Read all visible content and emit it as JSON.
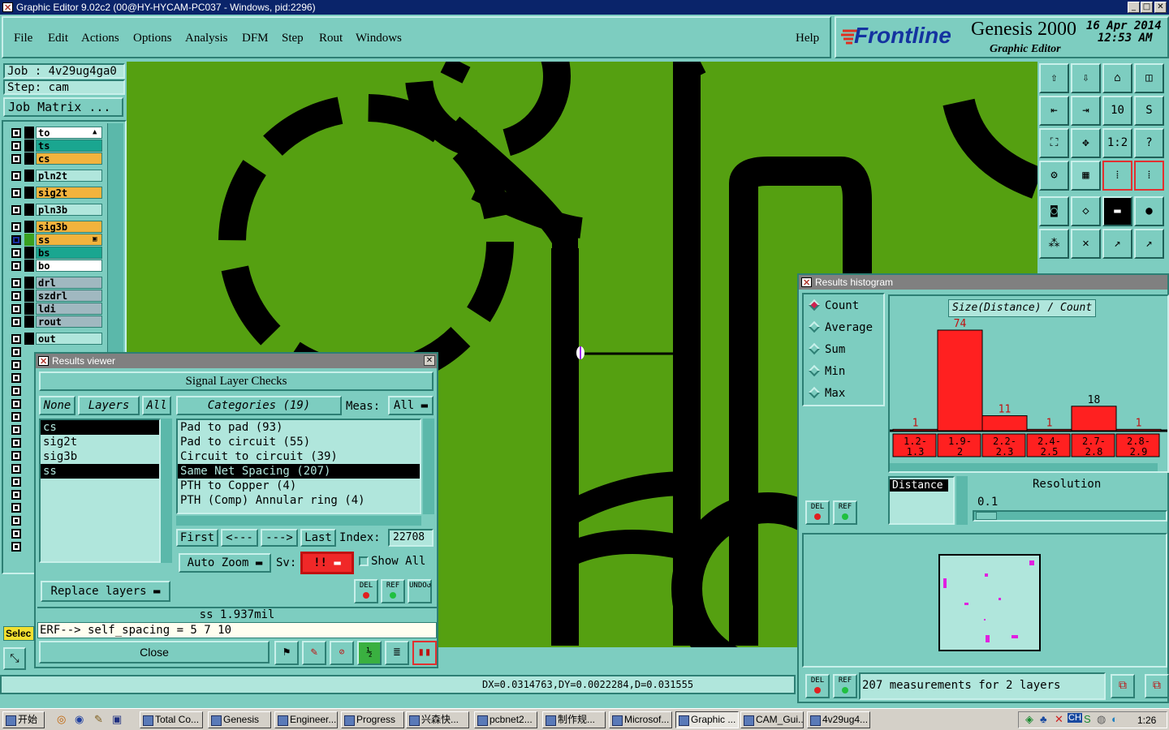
{
  "window": {
    "title": "Graphic Editor 9.02c2 (00@HY-HYCAM-PC037 - Windows, pid:2296)",
    "min": "_",
    "max": "□",
    "close": "✕"
  },
  "menu": [
    "File",
    "Edit",
    "Actions",
    "Options",
    "Analysis",
    "DFM",
    "Step",
    "Rout",
    "Windows"
  ],
  "help": "Help",
  "brand": {
    "logo": "Frontline",
    "product": "Genesis 2000",
    "subtitle": "Graphic Editor",
    "date": "16 Apr 2014",
    "time": "12:53 AM"
  },
  "job": {
    "job_label": "Job : 4v29ug4ga0",
    "step_label": "Step: cam",
    "matrix_button": "Job Matrix ..."
  },
  "layers": [
    {
      "name": "to",
      "color": "#ffffff",
      "mark": "▲"
    },
    {
      "name": "ts",
      "color": "#1aa690"
    },
    {
      "name": "cs",
      "color": "#f2b33d"
    },
    {
      "name": "pln2t",
      "color": "#b0e6dc"
    },
    {
      "name": "sig2t",
      "color": "#f2b33d"
    },
    {
      "name": "pln3b",
      "color": "#b0e6dc"
    },
    {
      "name": "sig3b",
      "color": "#f2b33d"
    },
    {
      "name": "ss",
      "color": "#f2b33d",
      "mark": "▣"
    },
    {
      "name": "bs",
      "color": "#1aa690"
    },
    {
      "name": "bo",
      "color": "#ffffff"
    },
    {
      "name": "drl",
      "color": "#a0b8c0"
    },
    {
      "name": "szdrl",
      "color": "#a0b8c0"
    },
    {
      "name": "ldi",
      "color": "#a0b8c0"
    },
    {
      "name": "rout",
      "color": "#a0b8c0"
    },
    {
      "name": "out",
      "color": "#b0e6dc"
    }
  ],
  "select_label": "Selec",
  "results_viewer": {
    "title": "Results viewer",
    "header": "Signal Layer Checks",
    "none": "None",
    "layers": "Layers",
    "all": "All",
    "layer_items": [
      {
        "name": "cs",
        "selected": true
      },
      {
        "name": "sig2t",
        "selected": false
      },
      {
        "name": "sig3b",
        "selected": false
      },
      {
        "name": "ss",
        "selected": true
      }
    ],
    "categories_btn": "Categories (19)",
    "meas_label": "Meas:",
    "meas_value": "All",
    "categories": [
      {
        "name": "Pad to pad (93)",
        "selected": false
      },
      {
        "name": "Pad to circuit (55)",
        "selected": false
      },
      {
        "name": "Circuit to circuit (39)",
        "selected": false
      },
      {
        "name": "Same Net Spacing (207)",
        "selected": true
      },
      {
        "name": "PTH to Copper (4)",
        "selected": false
      },
      {
        "name": "PTH (Comp) Annular ring (4)",
        "selected": false
      }
    ],
    "first": "First",
    "prev": "<---",
    "next": "--->",
    "last": "Last",
    "index_label": "Index:",
    "index_value": "22708",
    "auto_zoom": "Auto Zoom",
    "sv_label": "Sv:",
    "sv_value": "!!",
    "show_all": "Show All",
    "replace_layers": "Replace layers",
    "del": "DEL",
    "ref": "REF",
    "undo": "UNDO",
    "measure": "ss 1.937mil",
    "erf": "ERF--> self_spacing = 5 7 10",
    "close": "Close"
  },
  "histogram": {
    "title": "Results histogram",
    "modes": [
      {
        "name": "Count",
        "on": true
      },
      {
        "name": "Average",
        "on": false
      },
      {
        "name": "Sum",
        "on": false
      },
      {
        "name": "Min",
        "on": false
      },
      {
        "name": "Max",
        "on": false
      }
    ],
    "chart_title": "Size(Distance) / Count",
    "distance": "Distance",
    "resolution": "Resolution",
    "resolution_value": "0.1",
    "summary": "207 measurements for 2 layers",
    "del": "DEL",
    "ref": "REF"
  },
  "chart_data": {
    "type": "bar",
    "title": "Size(Distance) / Count",
    "categories": [
      "1.2-1.3",
      "1.9-2",
      "2.2-2.3",
      "2.4-2.5",
      "2.7-2.8",
      "2.8-2.9"
    ],
    "values": [
      1,
      74,
      11,
      1,
      18,
      1
    ],
    "ylim": [
      0,
      74
    ],
    "bar_color": "#ff2020"
  },
  "status": {
    "coords": "DX=0.0314763,DY=0.0022284,D=0.031555"
  },
  "taskbar": {
    "start": "开始",
    "tasks": [
      {
        "label": "Total Co...",
        "active": false
      },
      {
        "label": "Genesis",
        "active": false
      },
      {
        "label": "Engineer...",
        "active": false
      },
      {
        "label": "Progress",
        "active": false
      },
      {
        "label": "兴森快...",
        "active": false
      },
      {
        "label": "pcbnet2...",
        "active": false
      },
      {
        "label": "制作规...",
        "active": false
      },
      {
        "label": "Microsof...",
        "active": false
      },
      {
        "label": "Graphic ...",
        "active": true
      },
      {
        "label": "CAM_Gui...",
        "active": false
      },
      {
        "label": "4v29ug4...",
        "active": false
      }
    ],
    "clock": "1:26"
  }
}
